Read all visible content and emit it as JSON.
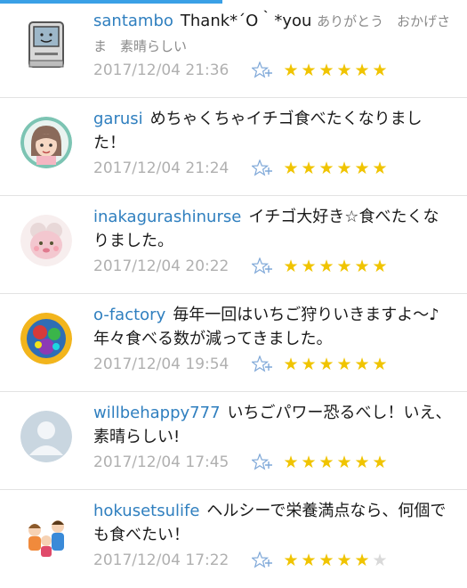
{
  "colors": {
    "username": "#2f7fbf",
    "star_on": "#f0c400",
    "star_off": "#d9d9d9",
    "timestamp": "#b0b0b0"
  },
  "comments": [
    {
      "username": "santambo",
      "text": "Thank*´O｀*you",
      "sub_text": "ありがとう　おかげさま　素晴らしい",
      "timestamp": "2017/12/04 21:36",
      "stars": 6,
      "avatar_icon": "retro-mac-icon"
    },
    {
      "username": "garusi",
      "text": "めちゃくちゃイチゴ食べたくなりました！",
      "timestamp": "2017/12/04 21:24",
      "stars": 6,
      "avatar_icon": "cartoon-girl-avatar"
    },
    {
      "username": "inakagurashinurse",
      "text": "イチゴ大好き☆食べたくなりました。",
      "timestamp": "2017/12/04 20:22",
      "stars": 6,
      "avatar_icon": "pink-character-avatar"
    },
    {
      "username": "o-factory",
      "text": "毎年一回はいちご狩りいきますよ～♪ 年々食べる数が減ってきました。",
      "timestamp": "2017/12/04 19:54",
      "stars": 6,
      "avatar_icon": "colorful-art-avatar"
    },
    {
      "username": "willbehappy777",
      "text": "いちごパワー恐るべし！いえ、素晴らしい!",
      "timestamp": "2017/12/04 17:45",
      "stars": 6,
      "avatar_icon": "default-user-avatar"
    },
    {
      "username": "hokusetsulife",
      "text": "ヘルシーで栄養満点なら、何個でも食べたい！",
      "timestamp": "2017/12/04 17:22",
      "stars": 5,
      "avatar_icon": "family-illustration-avatar"
    }
  ]
}
